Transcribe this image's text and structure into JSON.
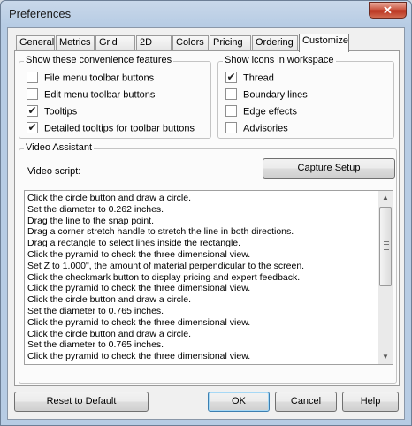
{
  "window": {
    "title": "Preferences",
    "close_glyph": "✕"
  },
  "tabs": [
    {
      "label": "General",
      "active": false
    },
    {
      "label": "Metrics",
      "active": false
    },
    {
      "label": "Grid",
      "active": false
    },
    {
      "label": "2D",
      "active": false
    },
    {
      "label": "Colors",
      "active": false
    },
    {
      "label": "Pricing",
      "active": false
    },
    {
      "label": "Ordering",
      "active": false
    },
    {
      "label": "Customize",
      "active": true
    }
  ],
  "convenience": {
    "legend": "Show these convenience features",
    "items": [
      {
        "label": "File menu toolbar buttons",
        "checked": false
      },
      {
        "label": "Edit menu toolbar buttons",
        "checked": false
      },
      {
        "label": "Tooltips",
        "checked": true
      },
      {
        "label": "Detailed tooltips for toolbar buttons",
        "checked": true
      }
    ]
  },
  "workspace_icons": {
    "legend": "Show icons in workspace",
    "items": [
      {
        "label": "Thread",
        "checked": true
      },
      {
        "label": "Boundary lines",
        "checked": false
      },
      {
        "label": "Edge effects",
        "checked": false
      },
      {
        "label": "Advisories",
        "checked": false
      }
    ]
  },
  "video_assistant": {
    "legend": "Video Assistant",
    "script_label": "Video script:",
    "capture_button": "Capture Setup",
    "script_lines": [
      "Click the circle button and draw a circle.",
      "Set the diameter to 0.262 inches.",
      "Drag the line to the snap point.",
      "Drag a corner stretch handle to stretch the line in both directions.",
      "Drag a rectangle to select lines inside the rectangle.",
      "Click the pyramid to check the three dimensional view.",
      "Set Z to 1.000\", the amount of material perpendicular to the screen.",
      "Click the checkmark button to display pricing and expert feedback.",
      "Click the pyramid to check the three dimensional view.",
      "Click the circle button and draw a circle.",
      "Set the diameter to 0.765 inches.",
      "Click the pyramid to check the three dimensional view.",
      "Click the circle button and draw a circle.",
      "Set the diameter to 0.765 inches.",
      "Click the pyramid to check the three dimensional view."
    ]
  },
  "footer": {
    "reset_label": "Reset to Default",
    "ok_label": "OK",
    "cancel_label": "Cancel",
    "help_label": "Help"
  },
  "check_glyph": "✔"
}
